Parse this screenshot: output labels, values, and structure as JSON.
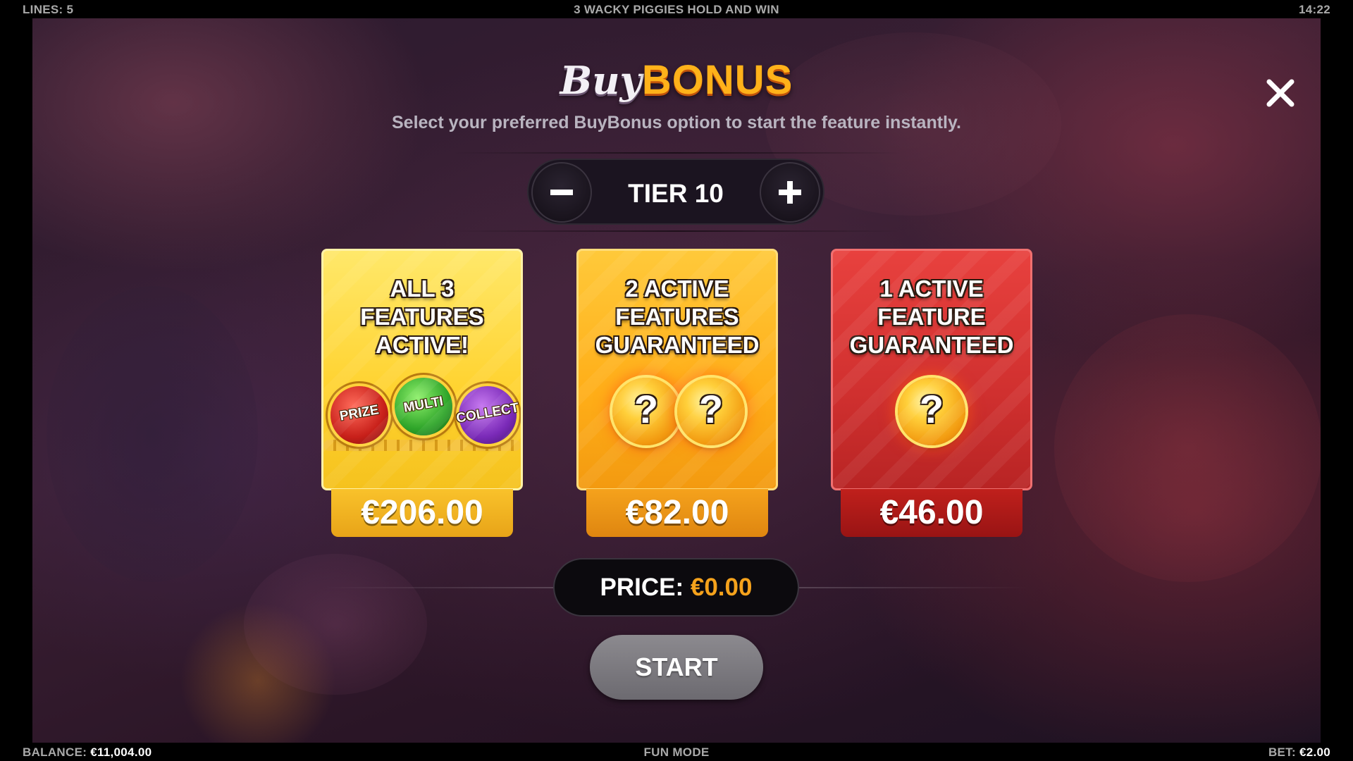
{
  "top_bar": {
    "lines": "LINES: 5",
    "game_title": "3 WACKY PIGGIES HOLD AND WIN",
    "clock": "14:22"
  },
  "header": {
    "title_buy": "Buy",
    "title_bonus": "BONUS",
    "subtitle": "Select your preferred BuyBonus option to start the feature instantly."
  },
  "tier": {
    "label": "TIER 10",
    "decrease_icon": "minus-icon",
    "increase_icon": "plus-icon"
  },
  "options": [
    {
      "lines": [
        "ALL 3",
        "FEATURES",
        "ACTIVE!"
      ],
      "price": "€206.00",
      "features": [
        "PRIZE",
        "MULTI",
        "COLLECT"
      ]
    },
    {
      "lines": [
        "2 ACTIVE",
        "FEATURES",
        "GUARANTEED"
      ],
      "price": "€82.00",
      "mystery_symbol": "?"
    },
    {
      "lines": [
        "1 ACTIVE",
        "FEATURE",
        "GUARANTEED"
      ],
      "price": "€46.00",
      "mystery_symbol": "?"
    }
  ],
  "price_bar": {
    "label": "PRICE:",
    "amount": "€0.00"
  },
  "start_button": "START",
  "close_icon": "close-icon",
  "bottom_bar": {
    "balance_label": "BALANCE:",
    "balance_value": "€11,004.00",
    "mode": "FUN MODE",
    "bet_label": "BET:",
    "bet_value": "€2.00"
  },
  "colors": {
    "bonus_orange": "#ffb21a",
    "card_yellow": "#ffd22e",
    "card_orange": "#ffae18",
    "card_red": "#d0302f",
    "price_accent": "#f5a21c",
    "start_gray": "#7c7a80"
  }
}
